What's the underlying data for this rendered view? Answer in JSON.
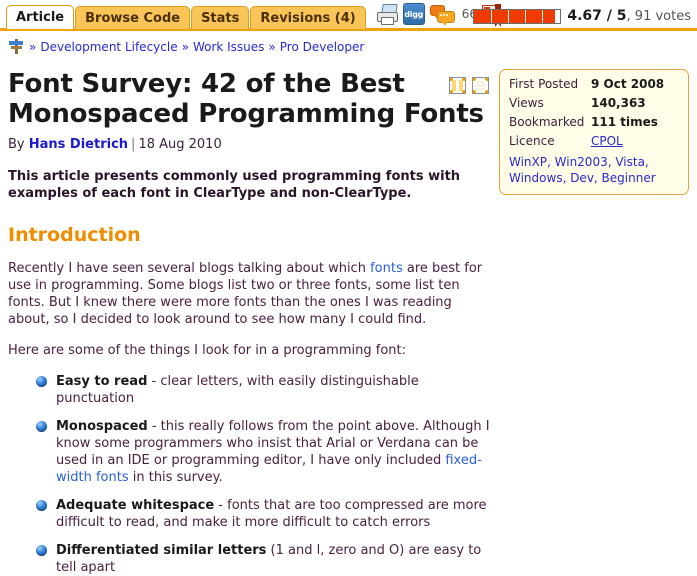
{
  "tabs": [
    {
      "label": "Article",
      "active": true
    },
    {
      "label": "Browse Code",
      "active": false
    },
    {
      "label": "Stats",
      "active": false
    },
    {
      "label": "Revisions (4)",
      "active": false
    }
  ],
  "toolbar": {
    "printer_icon": "printer-icon",
    "digg_icon": "digg-icon",
    "digg_label": "digg",
    "comments_icon": "comments-icon",
    "comments_count": "66",
    "bookmark_icon": "bookmark-icon"
  },
  "rating": {
    "score": "4.67",
    "scale": "5",
    "score_text": "4.67 / 5",
    "votes_text": ", 91 votes",
    "votes": "91",
    "fill_percent": 93.4,
    "bar_color": "#ef3b00"
  },
  "breadcrumb": {
    "home_icon": "signpost-icon",
    "items": [
      "Development Lifecycle",
      "Work Issues",
      "Pro Developer"
    ],
    "separator": "»"
  },
  "view_toggles": {
    "two_column": "two-column-view-icon",
    "one_column": "single-column-view-icon"
  },
  "infobox": {
    "rows": [
      {
        "key": "First Posted",
        "value": "9 Oct 2008",
        "is_link": false
      },
      {
        "key": "Views",
        "value": "140,363",
        "is_link": false
      },
      {
        "key": "Bookmarked",
        "value": "111 times",
        "is_link": false
      },
      {
        "key": "Licence",
        "value": "CPOL",
        "is_link": true
      }
    ],
    "tags": "WinXP, Win2003, Vista, Windows, Dev, Beginner"
  },
  "article": {
    "title": "Font Survey: 42 of the Best Monospaced Programming Fonts",
    "by_label": "By",
    "author": "Hans Dietrich",
    "separator": "|",
    "date": "18 Aug 2010",
    "abstract": "This article presents commonly used programming fonts with examples of each font in ClearType and non-ClearType.",
    "section_heading": "Introduction",
    "paragraph_1_part1": "Recently I have seen several blogs talking about which ",
    "paragraph_1_link": "fonts",
    "paragraph_1_part2": " are best for use in programming. Some blogs list two or three fonts, some list ten fonts. But I knew there were more fonts than the ones I was reading about, so I decided to look around to see how many I could find.",
    "paragraph_2": "Here are some of the things I look for in a programming font:",
    "bullets": [
      {
        "lead": "Easy to read",
        "text_1": " - clear letters, with easily distinguishable punctuation",
        "link": "",
        "text_2": ""
      },
      {
        "lead": "Monospaced",
        "text_1": " - this really follows from the point above. Although I know some programmers who insist that Arial or Verdana can be used in an IDE or programming editor, I have only included ",
        "link": "fixed-width fonts",
        "text_2": " in this survey."
      },
      {
        "lead": "Adequate whitespace",
        "text_1": " - fonts that are too compressed are more difficult to read, and make it more difficult to catch errors",
        "link": "",
        "text_2": ""
      },
      {
        "lead": "Differentiated similar letters",
        "text_1": " (1 and l, zero and O) are easy to tell apart",
        "link": "",
        "text_2": ""
      }
    ]
  },
  "colors": {
    "tab_orange": "#f9c558",
    "tab_border": "#e09b15",
    "accent_orange": "#f0a30a",
    "heading_orange": "#f08c00",
    "link_blue": "#2a2acc",
    "body_text": "#4a2040",
    "infobox_bg": "#fffce8"
  }
}
